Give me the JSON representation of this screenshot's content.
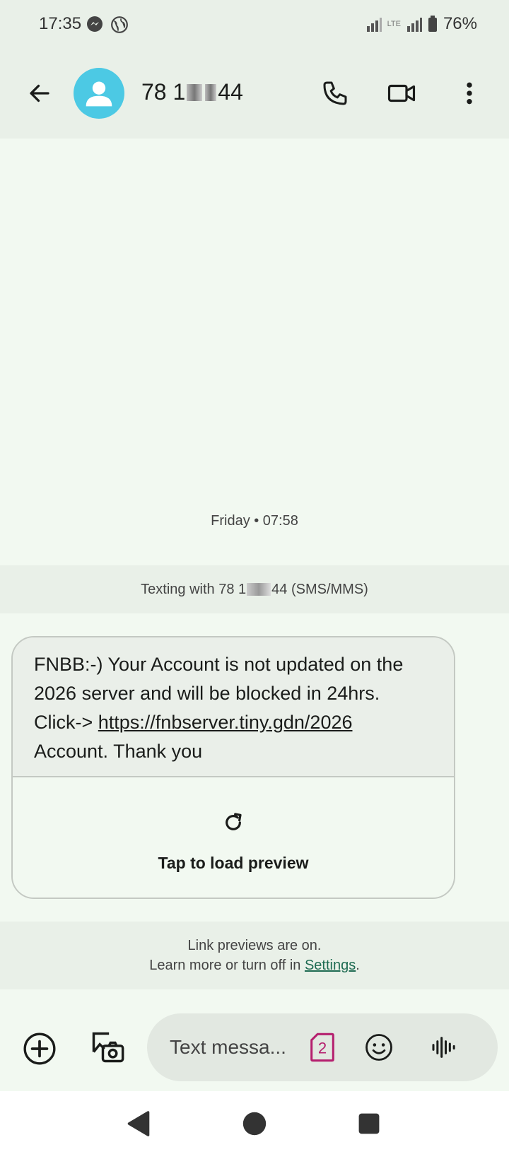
{
  "status": {
    "time": "17:35",
    "battery": "76%",
    "network": "LTE"
  },
  "header": {
    "contact_prefix": "78 1",
    "contact_suffix": "44"
  },
  "conversation": {
    "date_label": "Friday • 07:58",
    "banner_prefix": "Texting with 78 1",
    "banner_suffix": "44 (SMS/MMS)",
    "message": {
      "line1": "FNBB:-) Your Account is not updated on the",
      "line2": "2026 server and will be blocked in 24hrs.",
      "click_prefix": "Click-> ",
      "link": "https://fnbserver.tiny.gdn/2026",
      "line4": "Account. Thank you"
    },
    "preview_label": "Tap to load preview",
    "link_info_line1": "Link previews are on.",
    "link_info_line2": "Learn more or turn off in ",
    "link_info_settings": "Settings",
    "link_info_end": "."
  },
  "composer": {
    "placeholder": "Text messa...",
    "sim_number": "2"
  },
  "colors": {
    "accent_avatar": "#4cc9e4",
    "sim_badge": "#b5206f",
    "settings_link": "#1e6b52"
  }
}
